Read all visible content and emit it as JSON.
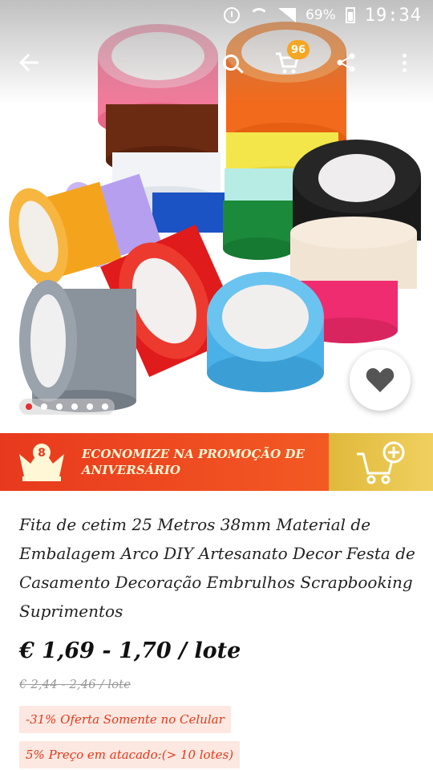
{
  "status_bar": {
    "battery": "69%",
    "time": "19:34"
  },
  "toolbar": {
    "cart_count": "96"
  },
  "gallery": {
    "slide_count": 6,
    "active_slide": 1
  },
  "promo": {
    "text": "ECONOMIZE NA PROMOÇÃO DE ANIVERSÁRIO",
    "crown_number": "8"
  },
  "product": {
    "title": "Fita de cetim 25 Metros 38mm Material de Embalagem Arco DIY Artesanato Decor Festa de Casamento Decoração Embrulhos Scrapbooking Suprimentos",
    "price": "€ 1,69 - 1,70 / lote",
    "original_price": "€ 2,44 - 2,46 / lote",
    "discount_tag": "-31% Oferta Somente no Celular",
    "wholesale_tag": "5% Preço em atacado:(> 10 lotes)"
  },
  "colors": {
    "brand_red": "#e8391e",
    "gold": "#e0b93a",
    "badge_orange": "#f5a623"
  }
}
